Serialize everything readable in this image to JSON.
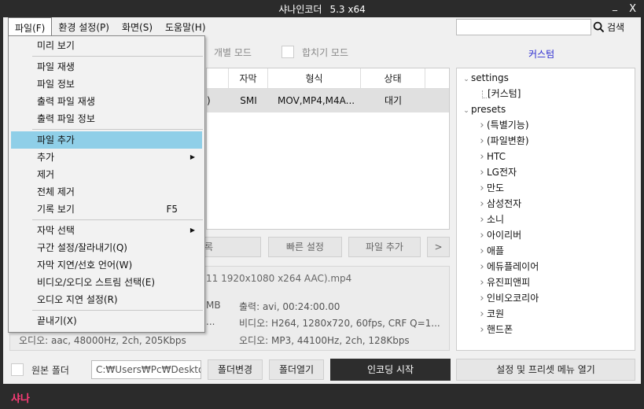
{
  "window": {
    "title": "샤나인코더",
    "version": "5.3  x64",
    "minimize": "_",
    "close": "X"
  },
  "menubar": [
    {
      "label": "파일(F)"
    },
    {
      "label": "환경 설정(P)"
    },
    {
      "label": "화면(S)"
    },
    {
      "label": "도움말(H)"
    }
  ],
  "search": {
    "value": "",
    "button_label": "검색",
    "icon": "search-icon"
  },
  "modes": {
    "individual": "개별 모드",
    "merge": "합치기 모드"
  },
  "custom_tab": "커스텀",
  "file_table": {
    "columns": [
      "자막",
      "형식",
      "상태"
    ],
    "row": {
      "prefix": ")",
      "subtitle": "SMI",
      "format": "MOV,MP4,M4A...",
      "status": "대기"
    }
  },
  "tree": [
    {
      "label": "settings",
      "level": 0,
      "expanded": true
    },
    {
      "label": "[커스텀]",
      "level": 1
    },
    {
      "label": "presets",
      "level": 0,
      "expanded": true
    },
    {
      "label": "(특별기능)",
      "level": 1
    },
    {
      "label": "(파일변환)",
      "level": 1
    },
    {
      "label": "HTC",
      "level": 1
    },
    {
      "label": "LG전자",
      "level": 1
    },
    {
      "label": "만도",
      "level": 1
    },
    {
      "label": "삼성전자",
      "level": 1
    },
    {
      "label": "소니",
      "level": 1
    },
    {
      "label": "아이리버",
      "level": 1
    },
    {
      "label": "애플",
      "level": 1
    },
    {
      "label": "에듀플레이어",
      "level": 1
    },
    {
      "label": "유진피앤피",
      "level": 1
    },
    {
      "label": "인비오코리아",
      "level": 1
    },
    {
      "label": "코원",
      "level": 1
    },
    {
      "label": "핸드폰",
      "level": 1
    }
  ],
  "action_buttons": {
    "partial": "록",
    "quick_settings": "빠른 설정",
    "add_file": "파일 추가",
    "next": ">"
  },
  "info": {
    "filename": "11 1920x1080 x264 AAC).mp4",
    "input_size_frag": "MB",
    "input_frag2": "...",
    "input_audio": "오디오: aac, 48000Hz, 2ch, 205Kbps",
    "output": "출력: avi, 00:24:00.00",
    "output_video": "비디오: H264, 1280x720, 60fps, CRF Q=1...",
    "output_audio": "오디오: MP3, 44100Hz, 2ch, 128Kbps"
  },
  "bottom": {
    "source_folder_label": "원본 폴더",
    "dir_value": "C:₩Users₩Pc₩Desktop",
    "change_folder": "폴더변경",
    "open_folder": "폴더열기",
    "start_encoding": "인코딩 시작",
    "settings_menu": "설정 및 프리셋 메뉴 열기"
  },
  "brand": "샤나",
  "file_menu": {
    "sections": [
      [
        {
          "label": "미리 보기"
        }
      ],
      [
        {
          "label": "파일 재생"
        },
        {
          "label": "파일 정보"
        },
        {
          "label": "출력 파일 재생"
        },
        {
          "label": "출력 파일 정보"
        }
      ],
      [
        {
          "label": "파일 추가",
          "highlighted": true
        },
        {
          "label": "추가",
          "submenu": true
        },
        {
          "label": "제거"
        },
        {
          "label": "전체 제거"
        },
        {
          "label": "기록 보기",
          "shortcut": "F5"
        }
      ],
      [
        {
          "label": "자막 선택",
          "submenu": true
        },
        {
          "label": "구간 설정/잘라내기(Q)"
        },
        {
          "label": "자막 지연/선호 언어(W)"
        },
        {
          "label": "비디오/오디오 스트림 선택(E)"
        },
        {
          "label": "오디오 지연 설정(R)"
        }
      ],
      [
        {
          "label": "끝내기(X)"
        }
      ]
    ]
  },
  "colors": {
    "accent_blue": "#2b2bd0",
    "brand_pink": "#ff3c78",
    "menu_highlight": "#8fcfe8",
    "dark_chrome": "#2b2b2b"
  }
}
